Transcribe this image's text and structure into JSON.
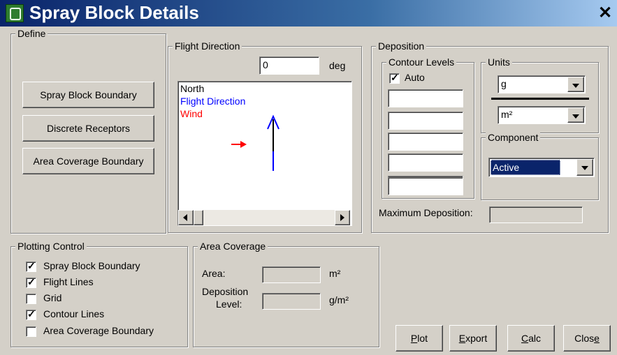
{
  "window": {
    "title": "Spray Block Details",
    "close_label": "✕"
  },
  "define": {
    "legend": "Define",
    "buttons": [
      "Spray Block Boundary",
      "Discrete Receptors",
      "Area Coverage Boundary"
    ]
  },
  "flight_direction": {
    "legend": "Flight Direction",
    "value": "0",
    "unit": "deg",
    "legend_items": [
      {
        "label": "North",
        "color": "#000000"
      },
      {
        "label": "Flight Direction",
        "color": "#0000ff"
      },
      {
        "label": "Wind",
        "color": "#ff0000"
      }
    ]
  },
  "deposition": {
    "legend": "Deposition",
    "contour_levels": {
      "legend": "Contour Levels",
      "auto_label": "Auto",
      "auto_checked": true,
      "levels": [
        "",
        "",
        "",
        "",
        "",
        ""
      ]
    },
    "units": {
      "legend": "Units",
      "numerator": "g",
      "denominator": "m²"
    },
    "component": {
      "legend": "Component",
      "value": "Active"
    },
    "max_label": "Maximum Deposition:",
    "max_value": ""
  },
  "plotting_control": {
    "legend": "Plotting Control",
    "items": [
      {
        "label": "Spray Block Boundary",
        "checked": true
      },
      {
        "label": "Flight Lines",
        "checked": true
      },
      {
        "label": "Grid",
        "checked": false
      },
      {
        "label": "Contour Lines",
        "checked": true
      },
      {
        "label": "Area Coverage Boundary",
        "checked": false
      }
    ]
  },
  "area_coverage": {
    "legend": "Area Coverage",
    "area_label": "Area:",
    "area_value": "",
    "area_unit": "m²",
    "deposition_label_1": "Deposition",
    "deposition_label_2": "Level:",
    "deposition_value": "",
    "deposition_unit": "g/m²"
  },
  "actions": {
    "plot": {
      "first": "P",
      "rest": "lot"
    },
    "export": {
      "first": "E",
      "rest": "xport"
    },
    "calc": {
      "first": "C",
      "rest": "alc"
    },
    "close": {
      "pre": "Clos",
      "ul": "e"
    }
  },
  "colors": {
    "north": "#000000",
    "flight_direction": "#0000ff",
    "wind": "#ff0000",
    "selection": "#0a246a"
  }
}
